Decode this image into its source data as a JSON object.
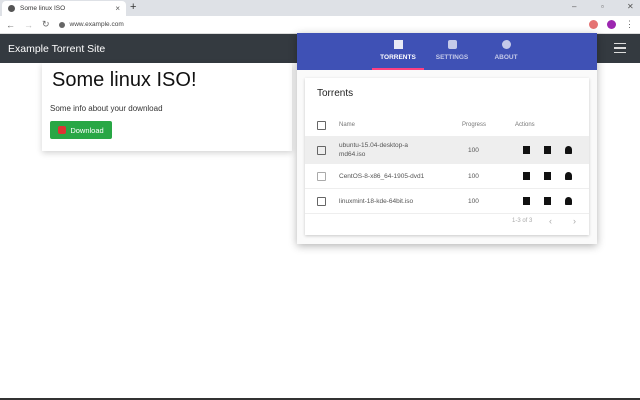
{
  "browser": {
    "tab_title": "Some linux ISO",
    "url": "www.example.com"
  },
  "site": {
    "brand": "Example Torrent Site",
    "title": "Some linux ISO!",
    "info": "Some info about your download",
    "download_label": "Download"
  },
  "popup": {
    "tabs": [
      {
        "label": "TORRENTS",
        "icon": "list-icon"
      },
      {
        "label": "SETTINGS",
        "icon": "gear-icon"
      },
      {
        "label": "ABOUT",
        "icon": "info-icon"
      }
    ],
    "card_title": "Torrents",
    "columns": {
      "name": "Name",
      "progress": "Progress",
      "actions": "Actions"
    },
    "rows": [
      {
        "name": "ubuntu-15.04-desktop-amd64.iso",
        "progress": "100"
      },
      {
        "name": "CentOS-8-x86_64-1905-dvd1",
        "progress": "100"
      },
      {
        "name": "linuxmint-18-kde-64bit.iso",
        "progress": "100"
      }
    ],
    "pagination": "1-3 of 3",
    "prev": "‹",
    "next": "›"
  },
  "colors": {
    "header": "#3f51b5",
    "accent": "#ff4081",
    "navbar": "#343a40",
    "download": "#28a745"
  }
}
